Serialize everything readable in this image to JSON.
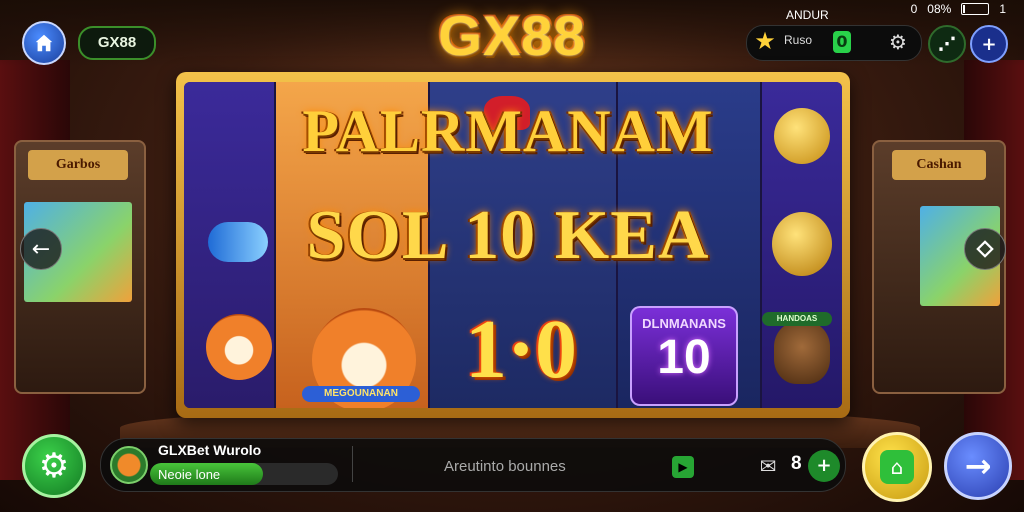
{
  "header": {
    "brand_pill": "GX88",
    "logo_text": "GX88",
    "carrier": "ANDUR",
    "status_left": "0",
    "battery_percent": "08%",
    "battery_level": 0.08,
    "status_right": "1",
    "coin_label": "Ruso",
    "chip_value": "0"
  },
  "slot": {
    "headline_line1": "PALRMANAM",
    "headline_line2": "SOL 10 KEA",
    "big_number": "1·0",
    "purple_badge_title": "DLNMANANS",
    "purple_badge_number": "10",
    "fox_banner": "MEGOUNANAN",
    "bird_banner": "HANDOAS"
  },
  "arcades": {
    "left_title": "Garbos",
    "right_title": "Cashan"
  },
  "bottom": {
    "player_name": "GLXBet Wurolo",
    "xp_text": "Neoie lone",
    "xp_level": 0.6,
    "center_text": "Areutinto bounnes",
    "count": "8"
  },
  "colors": {
    "logo_gold": "#ffd23a",
    "green_accent": "#29d14a",
    "blue_accent": "#2b3fb0"
  },
  "icons": {
    "home": "home-icon",
    "star": "star-icon",
    "gear": "gear-icon",
    "share": "share-icon",
    "plus": "plus-icon",
    "prev": "arrow-left-icon",
    "next": "arrow-right-icon",
    "chat": "chat-icon",
    "shop": "shop-icon"
  }
}
